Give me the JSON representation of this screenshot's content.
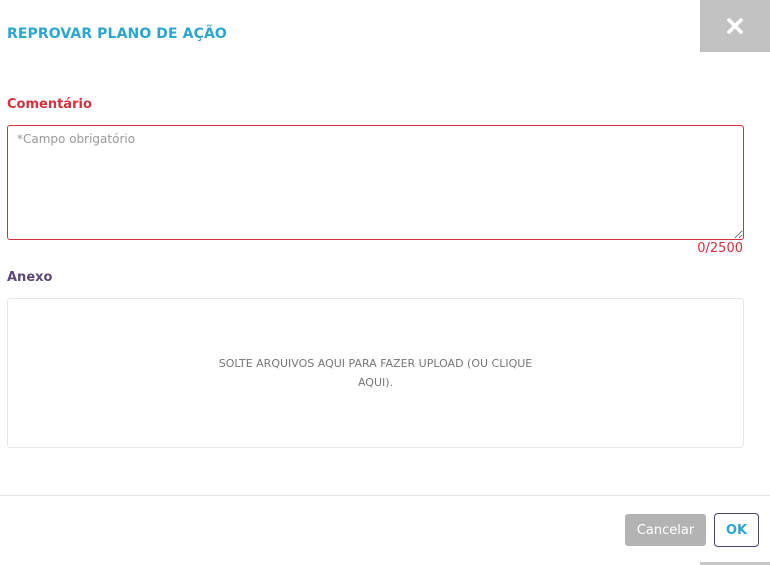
{
  "dialog": {
    "title": "REPROVAR PLANO DE AÇÃO",
    "close_icon": "close-icon"
  },
  "comment": {
    "label": "Comentário",
    "value": "",
    "placeholder": "*Campo obrigatório",
    "counter": "0/2500"
  },
  "attachment": {
    "label": "Anexo",
    "dropzone_text": "SOLTE ARQUIVOS AQUI PARA FAZER UPLOAD (OU CLIQUE AQUI)."
  },
  "footer": {
    "cancel_label": "Cancelar",
    "ok_label": "OK"
  },
  "colors": {
    "title": "#2ba6cf",
    "error": "#d62f3d",
    "section_label": "#5b4a74",
    "close_bg": "#c2c2c2",
    "cancel_bg": "#b3b3b3"
  }
}
